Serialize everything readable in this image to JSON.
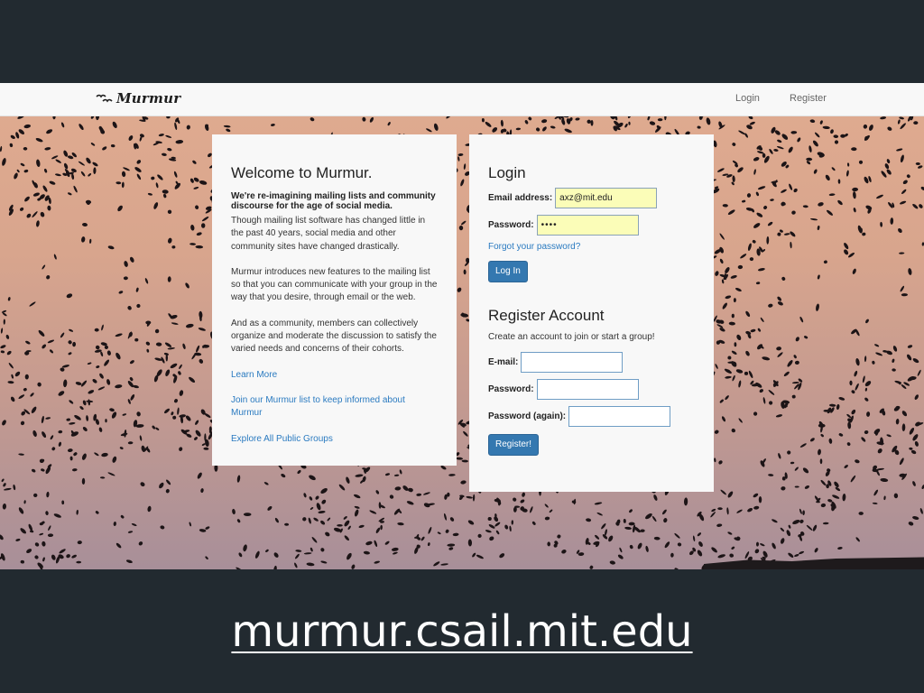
{
  "navbar": {
    "brand": "Murmur",
    "brand_icon": "birds-logo-icon",
    "links": [
      "Login",
      "Register"
    ]
  },
  "welcome": {
    "title": "Welcome to Murmur.",
    "tagline": "We're re-imagining mailing lists and community discourse for the age of social media.",
    "paragraphs": [
      "Though mailing list software has changed little in the past 40 years, social media and other community sites have changed drastically.",
      "Murmur introduces new features to the mailing list so that you can communicate with your group in the way that you desire, through email or the web.",
      "And as a community, members can collectively organize and moderate the discussion to satisfy the varied needs and concerns of their cohorts."
    ],
    "links": [
      "Learn More",
      "Join our Murmur list to keep informed about Murmur",
      "Explore All Public Groups"
    ]
  },
  "login": {
    "title": "Login",
    "email_label": "Email address:",
    "email_value": "axz@mit.edu",
    "password_label": "Password:",
    "password_value": "••••",
    "forgot": "Forgot your password?",
    "button": "Log In"
  },
  "register": {
    "title": "Register Account",
    "subtitle": "Create an account to join or start a group!",
    "email_label": "E-mail:",
    "password_label": "Password:",
    "password_again_label": "Password (again):",
    "button": "Register!"
  },
  "caption": "murmur.csail.mit.edu",
  "colors": {
    "slide_background": "#222a30",
    "link": "#2a7ac0",
    "button": "#3478b0",
    "autofill": "#fbfdb8"
  }
}
